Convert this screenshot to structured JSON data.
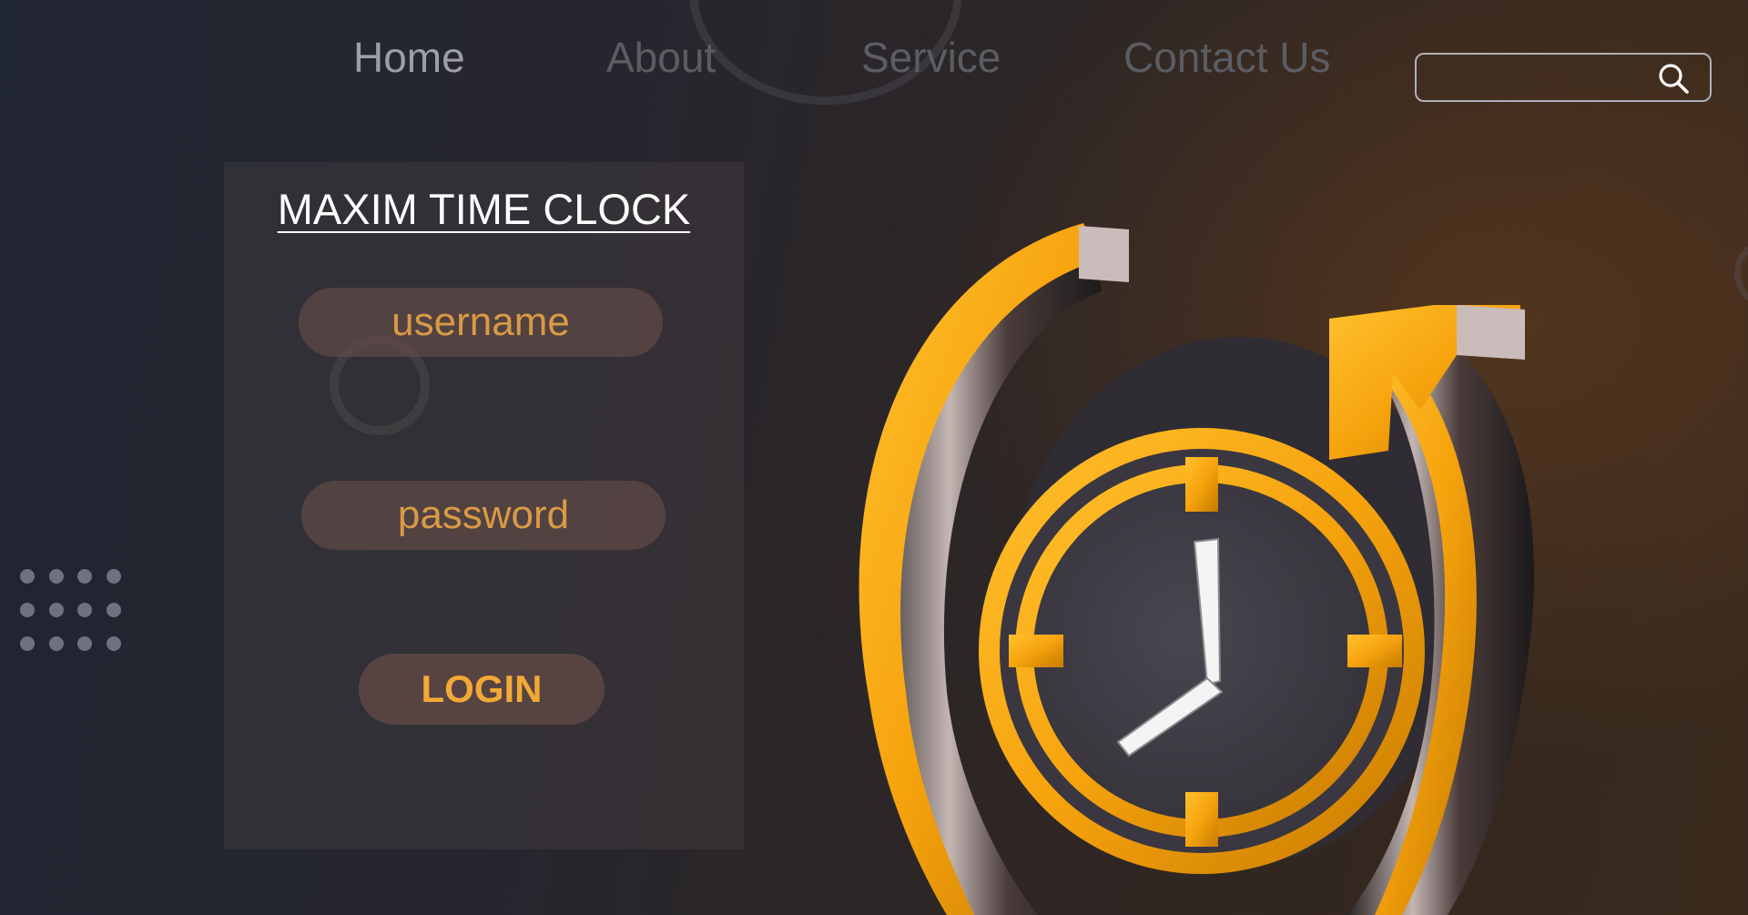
{
  "nav": {
    "items": [
      {
        "label": "Home"
      },
      {
        "label": "About"
      },
      {
        "label": "Service"
      },
      {
        "label": "Contact Us"
      }
    ]
  },
  "search": {
    "value": "",
    "placeholder": "",
    "icon": "search-icon"
  },
  "login": {
    "title": "MAXIM TIME CLOCK",
    "username_placeholder": "username",
    "password_placeholder": "password",
    "button_label": "LOGIN"
  },
  "colors": {
    "accent": "#f3a936",
    "field_bg": "#604a46",
    "nav_active": "#9d9fa4",
    "nav_inactive": "#5b5d63"
  },
  "icons": {
    "hero": "clock-refresh-icon",
    "decor": "dot-grid"
  }
}
